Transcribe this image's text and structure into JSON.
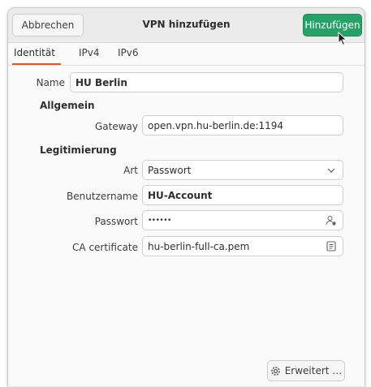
{
  "header": {
    "title": "VPN hinzufügen",
    "cancel_label": "Abbrechen",
    "add_label": "Hinzufügen",
    "accent_color": "#26a269"
  },
  "tabs": [
    {
      "label": "Identität",
      "active": true
    },
    {
      "label": "IPv4",
      "active": false
    },
    {
      "label": "IPv6",
      "active": false
    }
  ],
  "form": {
    "name_label": "Name",
    "name_value": "HU Berlin",
    "general_section": "Allgemein",
    "gateway_label": "Gateway",
    "gateway_value": "open.vpn.hu-berlin.de:1194",
    "auth_section": "Legitimierung",
    "type_label": "Art",
    "type_value": "Passwort",
    "username_label": "Benutzername",
    "username_value": "HU-Account",
    "password_label": "Passwort",
    "password_value": "••••••",
    "ca_label": "CA certificate",
    "ca_value": "hu-berlin-full-ca.pem"
  },
  "footer": {
    "advanced_label": "Erweitert …"
  },
  "icons": {
    "select": "chevron-down-icon",
    "password": "user-key-icon",
    "file": "file-chooser-icon",
    "advanced": "gear-icon"
  }
}
